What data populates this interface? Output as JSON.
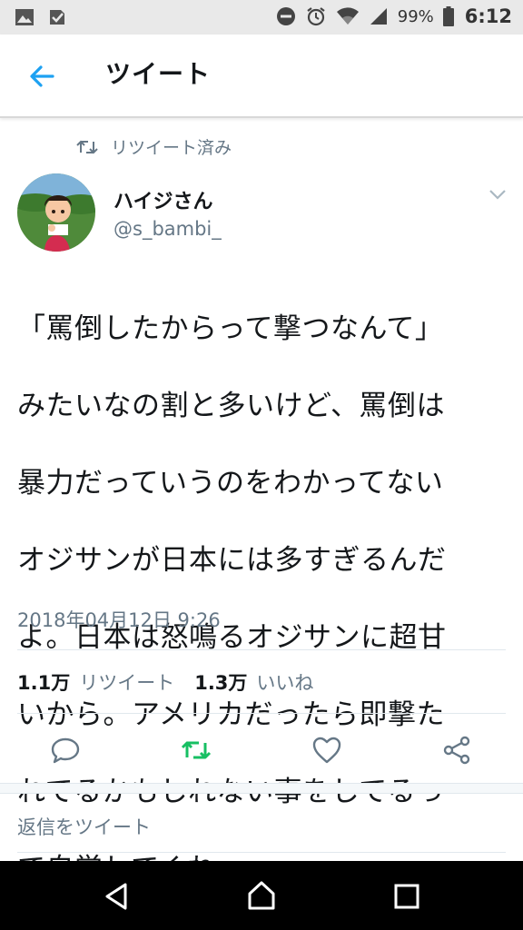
{
  "status_bar": {
    "battery": "99%",
    "time": "6:12",
    "left_icons": [
      "gallery-icon",
      "checkbox-icon"
    ],
    "right_icons": [
      "dnd-icon",
      "alarm-icon",
      "wifi-icon",
      "signal-icon",
      "battery-icon"
    ]
  },
  "header": {
    "title": "ツイート",
    "back_icon": "back-arrow-icon"
  },
  "retweet_banner": {
    "text": "リツイート済み",
    "icon": "retweet-icon"
  },
  "user": {
    "name": "ハイジさん",
    "handle": "@s_bambi_"
  },
  "tweet": {
    "lines": [
      "「罵倒したからって撃つなんて」",
      "みたいなの割と多いけど、罵倒は",
      "暴力だっていうのをわかってない",
      "オジサンが日本には多すぎるんだ",
      "よ。日本は怒鳴るオジサンに超甘",
      "いから。アメリカだったら即撃た",
      "れてるかもしれない事をしてるっ",
      "て自覚してくれ"
    ],
    "timestamp": "2018年04月12日 9:26"
  },
  "stats": {
    "retweets_count": "1.1万",
    "retweets_label": "リツイート",
    "likes_count": "1.3万",
    "likes_label": "いいね"
  },
  "actions": [
    "reply-icon",
    "retweet-icon",
    "like-icon",
    "share-icon"
  ],
  "reply_box": {
    "placeholder": "返信をツイート"
  },
  "colors": {
    "accent": "#1da1f2",
    "retweet_green": "#17bf63",
    "gray": "#657786"
  }
}
